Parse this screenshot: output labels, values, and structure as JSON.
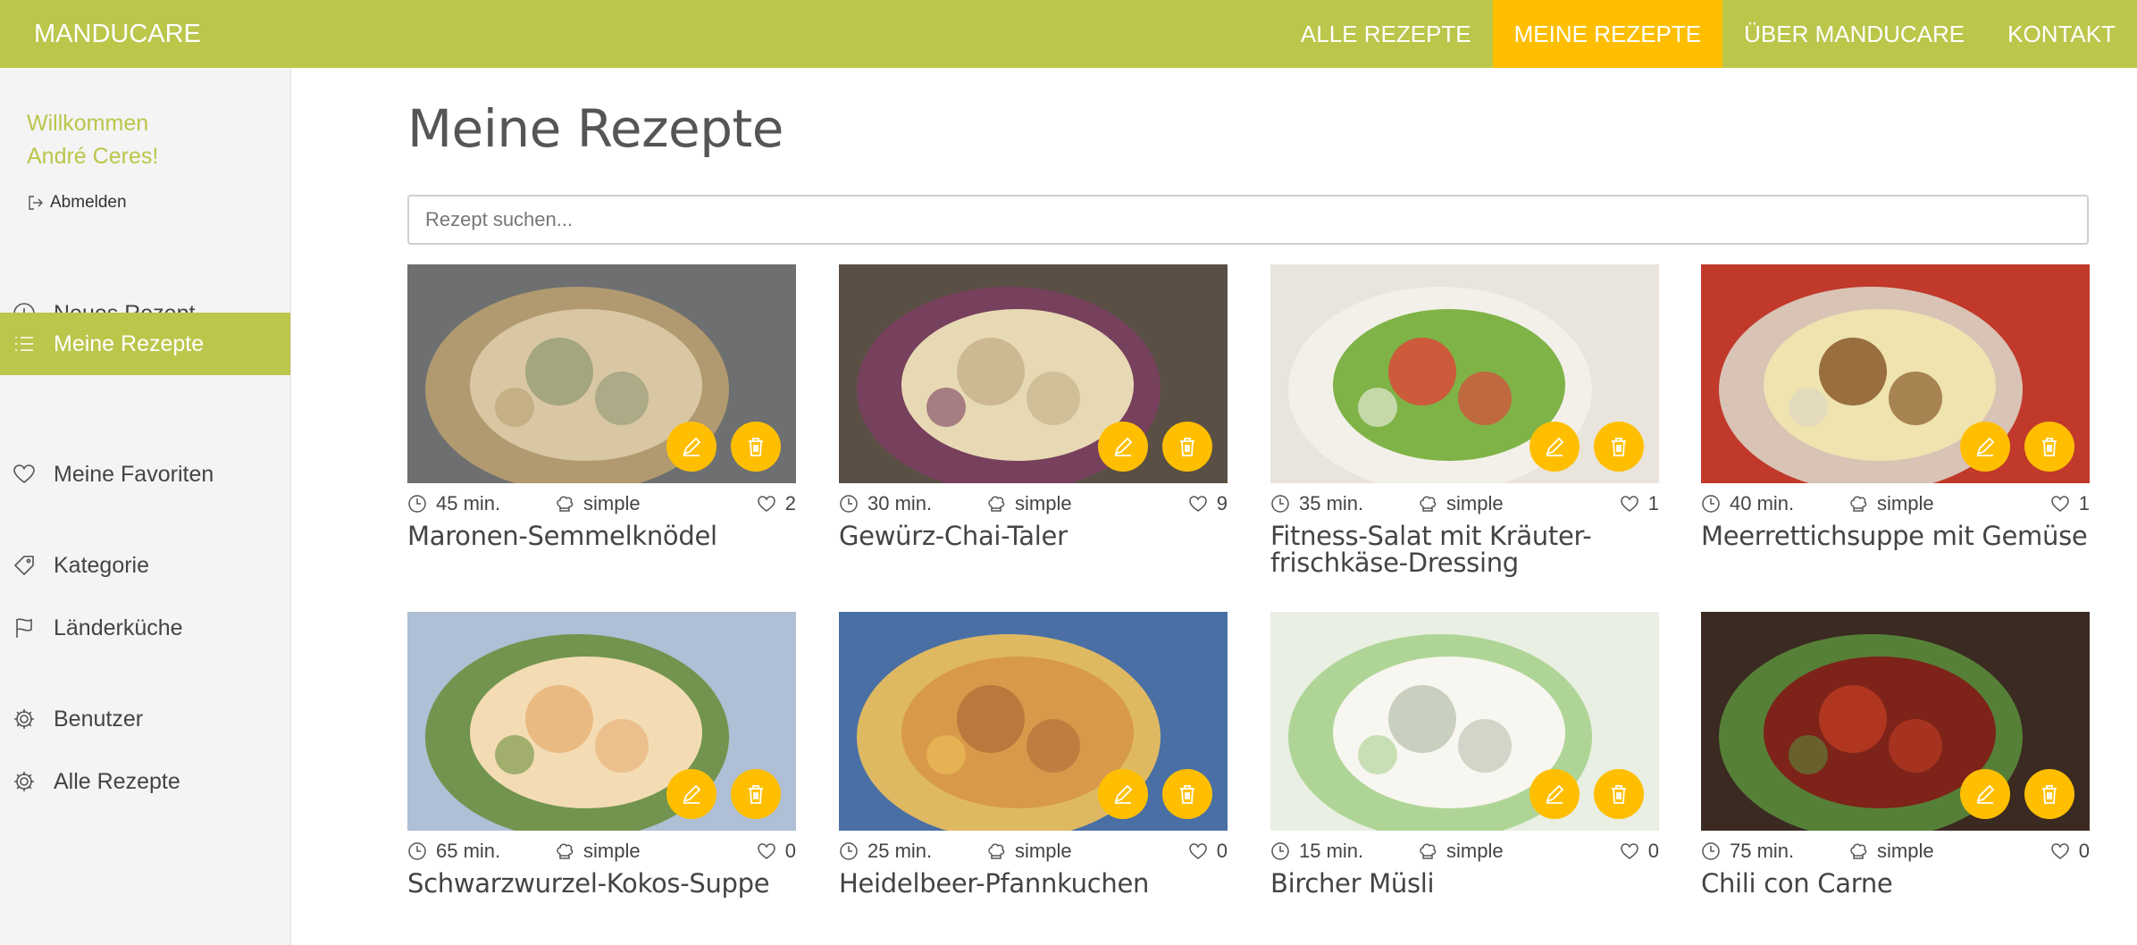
{
  "brand": "MANDUCARE",
  "nav": [
    {
      "label": "ALLE REZEPTE"
    },
    {
      "label": "MEINE REZEPTE"
    },
    {
      "label": "ÜBER MANDUCARE"
    },
    {
      "label": "KONTAKT"
    }
  ],
  "sidebar": {
    "welcome_line1": "Willkommen",
    "welcome_line2": "André Ceres!",
    "logout": "Abmelden",
    "items": [
      {
        "label": "Neues Rezept",
        "icon": "plus-circle-icon"
      },
      {
        "label": "Meine Rezepte",
        "icon": "list-icon"
      },
      {
        "label": "Meine Favoriten",
        "icon": "heart-icon"
      },
      {
        "label": "Kategorie",
        "icon": "tag-icon"
      },
      {
        "label": "Länderküche",
        "icon": "flag-icon"
      },
      {
        "label": "Benutzer",
        "icon": "gear-icon"
      },
      {
        "label": "Alle Rezepte",
        "icon": "gear-icon"
      }
    ]
  },
  "page": {
    "title": "Meine Rezepte",
    "search_placeholder": "Rezept suchen..."
  },
  "recipes": [
    {
      "title": "Maronen-Semmelknödel",
      "time": "45 min.",
      "level": "simple",
      "likes": "2"
    },
    {
      "title": "Gewürz-Chai-Taler",
      "time": "30 min.",
      "level": "simple",
      "likes": "9"
    },
    {
      "title": "Fitness-Salat mit Kräuter-frischkäse-Dressing",
      "title_line1": "Fitness-Salat mit Kräuter-",
      "title_line2": "frischkäse-Dressing",
      "time": "35 min.",
      "level": "simple",
      "likes": "1"
    },
    {
      "title": "Meerrettichsuppe mit Gemüse",
      "time": "40 min.",
      "level": "simple",
      "likes": "1"
    },
    {
      "title": "Schwarzwurzel-Kokos-Suppe",
      "time": "65 min.",
      "level": "simple",
      "likes": "0"
    },
    {
      "title": "Heidelbeer-Pfannkuchen",
      "time": "25 min.",
      "level": "simple",
      "likes": "0"
    },
    {
      "title": "Bircher Müsli",
      "time": "15 min.",
      "level": "simple",
      "likes": "0"
    },
    {
      "title": "Chili con Carne",
      "time": "75 min.",
      "level": "simple",
      "likes": "0"
    }
  ],
  "colors": {
    "accent_green": "#bbc64b",
    "accent_yellow": "#ffbf00",
    "text": "#444444"
  }
}
